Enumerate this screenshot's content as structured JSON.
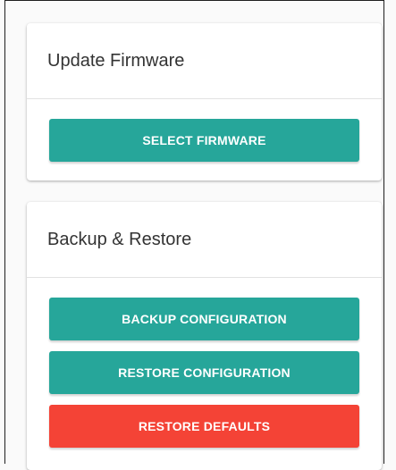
{
  "colors": {
    "primary": "#26a69a",
    "danger": "#f44336",
    "card_background": "#ffffff",
    "page_background": "#fafafa"
  },
  "firmware_card": {
    "title": "Update Firmware",
    "select_button_label": "SELECT FIRMWARE"
  },
  "backup_card": {
    "title": "Backup & Restore",
    "backup_button_label": "BACKUP CONFIGURATION",
    "restore_button_label": "RESTORE CONFIGURATION",
    "defaults_button_label": "RESTORE DEFAULTS"
  }
}
